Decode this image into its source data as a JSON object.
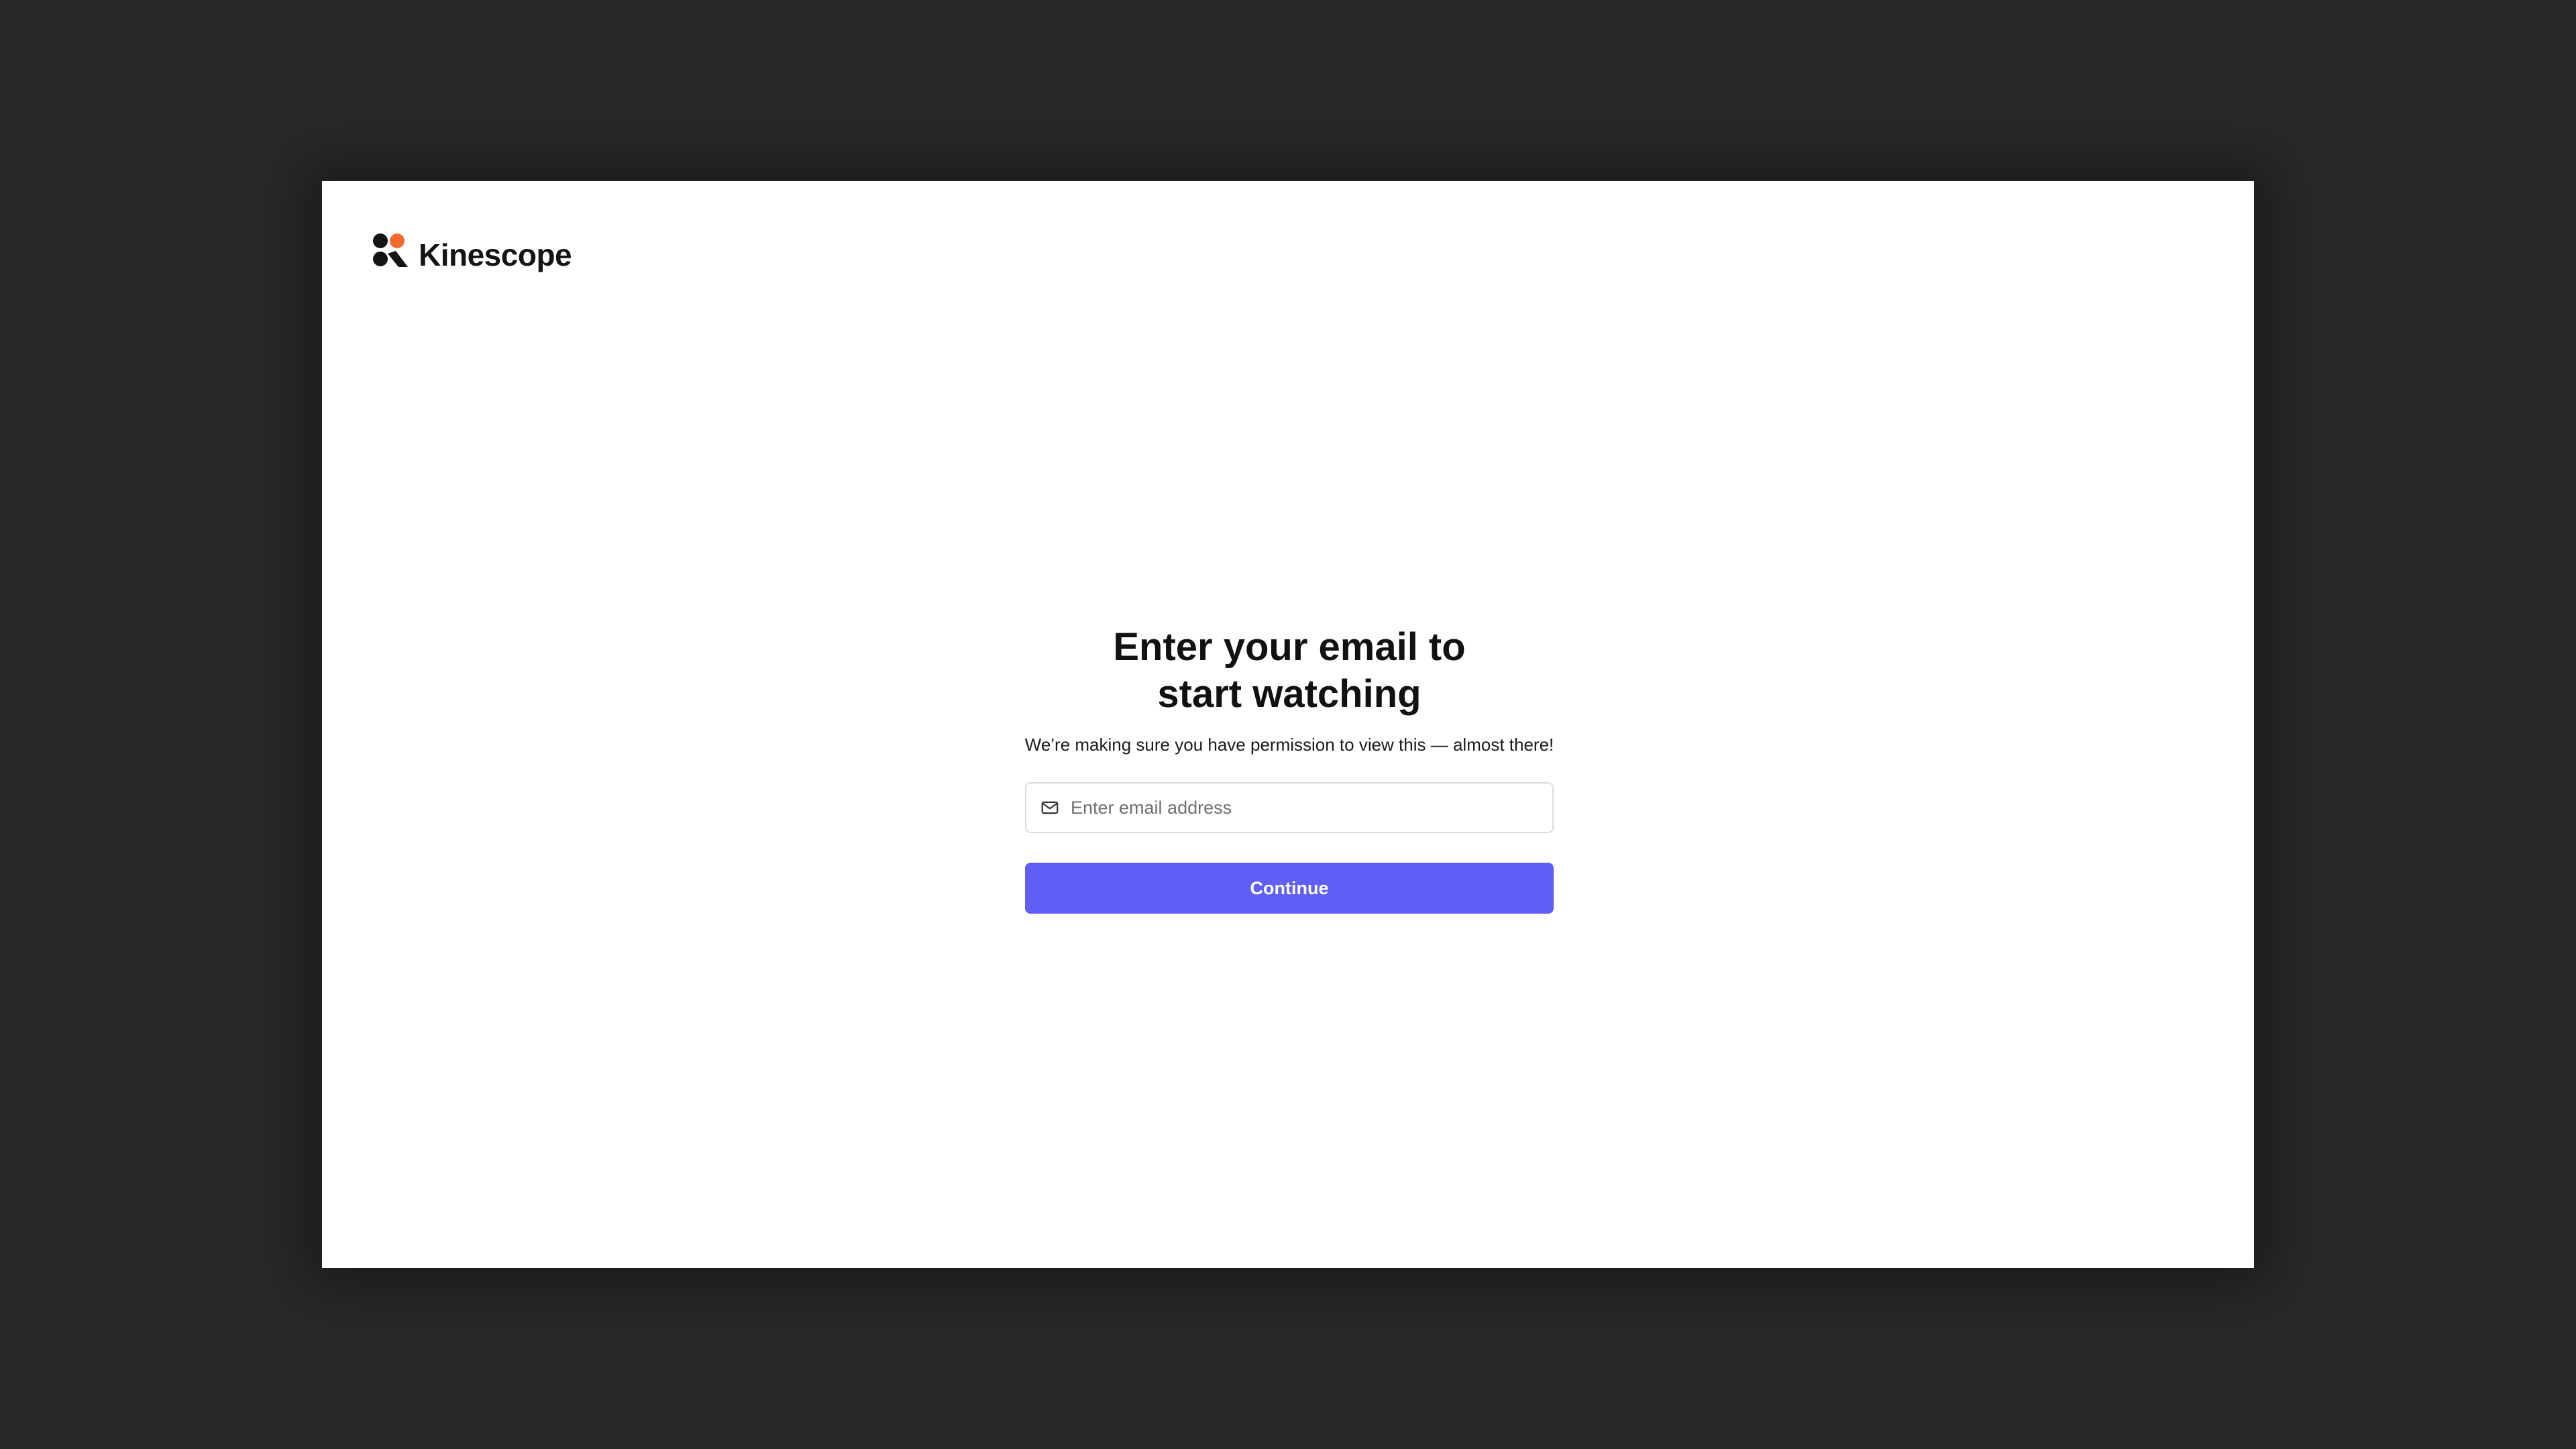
{
  "brand": {
    "name": "Kinescope",
    "logo_icon": "kinescope-logo-icon",
    "accent_color": "#f26b2c",
    "mark_color": "#141414"
  },
  "auth": {
    "title_line1": "Enter your email to",
    "title_line2": "start watching",
    "subtitle": "We’re making sure you have permission to view this — almost there!",
    "email": {
      "icon": "mail-icon",
      "placeholder": "Enter email address",
      "value": ""
    },
    "continue_label": "Continue",
    "button_color": "#5f5ff6"
  }
}
